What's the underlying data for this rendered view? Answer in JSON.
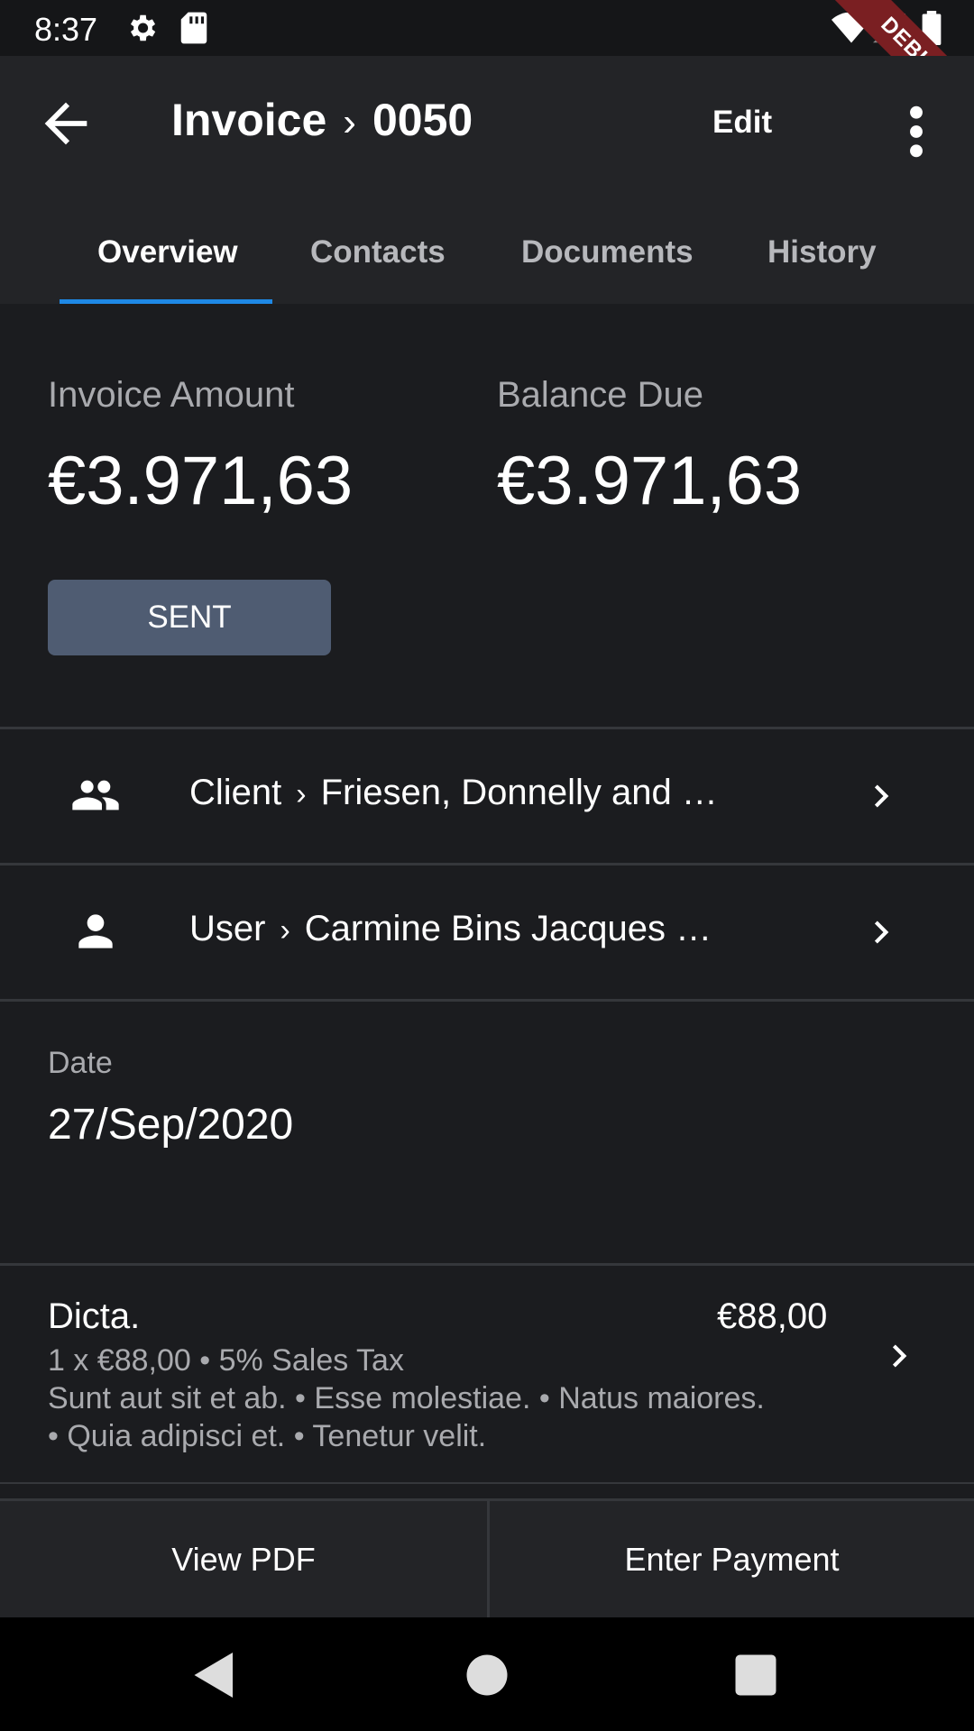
{
  "status_bar": {
    "time": "8:37",
    "debug_label": "DEBUG"
  },
  "app_bar": {
    "title_entity": "Invoice",
    "title_separator": "›",
    "title_number": "0050",
    "edit_label": "Edit"
  },
  "tabs": [
    {
      "label": "Overview",
      "active": true
    },
    {
      "label": "Contacts"
    },
    {
      "label": "Documents"
    },
    {
      "label": "History"
    }
  ],
  "amounts": {
    "invoice_amount_label": "Invoice Amount",
    "invoice_amount_value": "€3.971,63",
    "balance_due_label": "Balance Due",
    "balance_due_value": "€3.971,63"
  },
  "status": {
    "label": "SENT",
    "color": "#4f5c72"
  },
  "links": {
    "client": {
      "label": "Client",
      "separator": "›",
      "value": "Friesen, Donnelly and …",
      "icon": "group-icon"
    },
    "user": {
      "label": "User",
      "separator": "›",
      "value": "Carmine Bins Jacques …",
      "icon": "person-icon"
    }
  },
  "date": {
    "label": "Date",
    "value": "27/Sep/2020"
  },
  "line_item": {
    "name": "Dicta.",
    "total": "€88,00",
    "detail_1": "1 x €88,00 • 5% Sales Tax",
    "detail_2": "Sunt aut sit et ab. • Esse molestiae. • Natus maiores.",
    "detail_3": "• Quia adipisci et. • Tenetur velit."
  },
  "actions": {
    "view_pdf": "View PDF",
    "enter_payment": "Enter Payment"
  },
  "colors": {
    "accent": "#1e88e5",
    "background": "#1b1c1f",
    "surface": "#232427"
  }
}
